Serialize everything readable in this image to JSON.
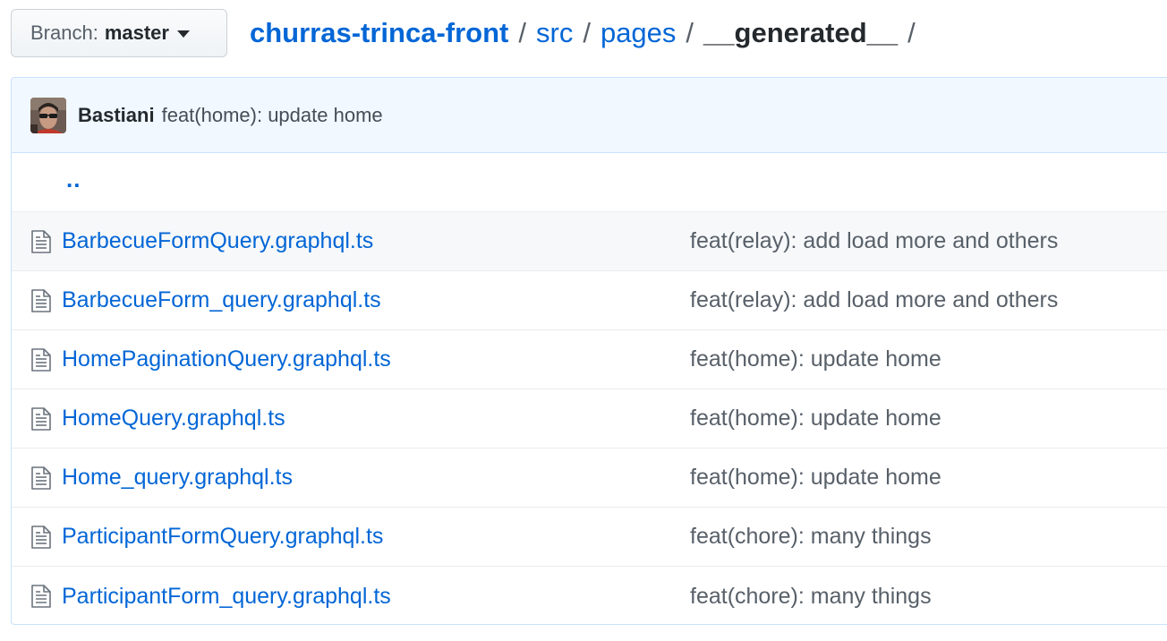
{
  "branch": {
    "label": "Branch:",
    "value": "master"
  },
  "breadcrumb": {
    "repo": "churras-trinca-front",
    "path": [
      "src",
      "pages"
    ],
    "current": "__generated__",
    "separator": "/"
  },
  "latest_commit": {
    "author": "Bastiani",
    "message": "feat(home): update home"
  },
  "parent_dir": "..",
  "files": [
    {
      "name": "BarbecueFormQuery.graphql.ts",
      "commit": "feat(relay): add load more and others"
    },
    {
      "name": "BarbecueForm_query.graphql.ts",
      "commit": "feat(relay): add load more and others"
    },
    {
      "name": "HomePaginationQuery.graphql.ts",
      "commit": "feat(home): update home"
    },
    {
      "name": "HomeQuery.graphql.ts",
      "commit": "feat(home): update home"
    },
    {
      "name": "Home_query.graphql.ts",
      "commit": "feat(home): update home"
    },
    {
      "name": "ParticipantFormQuery.graphql.ts",
      "commit": "feat(chore): many things"
    },
    {
      "name": "ParticipantForm_query.graphql.ts",
      "commit": "feat(chore): many things"
    }
  ],
  "icons": {
    "caret": "caret-down-icon",
    "file": "file-text-icon",
    "avatar": "user-avatar"
  },
  "colors": {
    "link": "#0366d6",
    "commit_bar_bg": "#f1f8ff",
    "border": "#c8e1ff",
    "muted_text": "#586069"
  }
}
